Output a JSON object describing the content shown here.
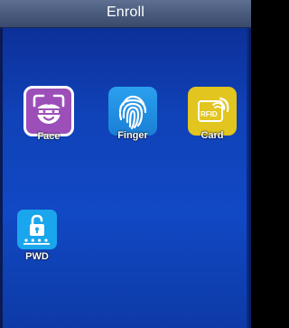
{
  "header": {
    "title": "Enroll"
  },
  "menu": {
    "items": [
      {
        "label": "Face",
        "icon": "face-scan-icon",
        "color": "#9c4fb8"
      },
      {
        "label": "Finger",
        "icon": "fingerprint-icon",
        "color": "#2aa0ee"
      },
      {
        "label": "Card",
        "icon": "rfid-card-icon",
        "color": "#e2c51e",
        "icon_text": "RFID"
      },
      {
        "label": "PWD",
        "icon": "password-lock-icon",
        "color": "#1aa6ec"
      }
    ]
  }
}
